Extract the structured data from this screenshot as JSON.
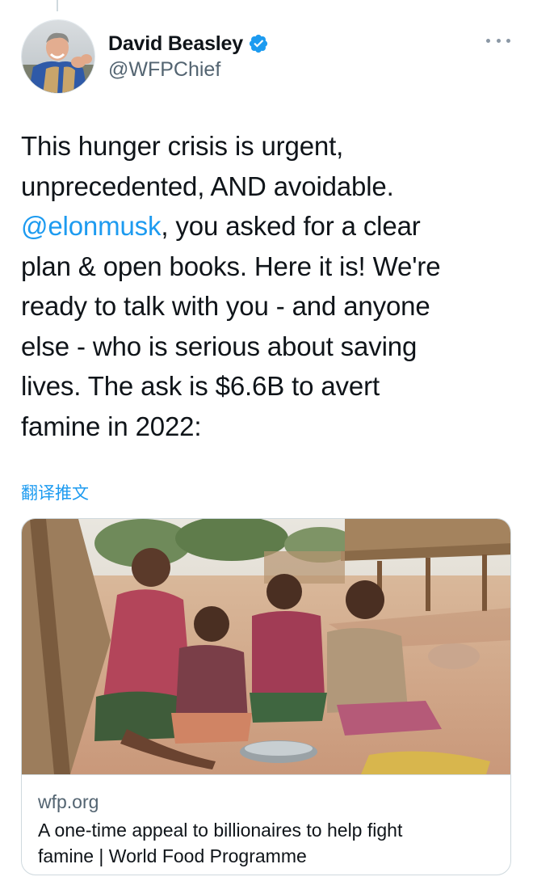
{
  "tweet": {
    "author": {
      "display_name": "David Beasley",
      "handle": "@WFPChief",
      "verified": true
    },
    "text_lines": [
      [
        "This hunger crisis is urgent,"
      ],
      [
        "unprecedented, AND avoidable."
      ],
      [
        "",
        ", you asked for a clear"
      ],
      [
        "plan & open books. Here it is! We're"
      ],
      [
        "ready to talk with you - and anyone"
      ],
      [
        "else - who is serious about saving"
      ],
      [
        "lives. The ask is $6.6B to avert"
      ],
      [
        "famine in 2022:"
      ]
    ],
    "line1": "This hunger crisis is urgent,",
    "line2": "unprecedented, AND avoidable.",
    "mention": "@elonmusk",
    "line3_rest": ", you asked for a clear",
    "line4": "plan & open books. Here it is! We're",
    "line5": "ready to talk with you - and anyone",
    "line6": "else - who is serious about saving",
    "line7": "lives. The ask is $6.6B to avert",
    "line8": "famine in 2022:",
    "translate_label": "翻译推文"
  },
  "link_card": {
    "domain": "wfp.org",
    "title_line1": "A one-time appeal to billionaires to help fight",
    "title_line2": "famine | World Food Programme"
  },
  "colors": {
    "link_blue": "#1d9bf0",
    "verified_blue": "#1d9bf0",
    "secondary_text": "#536471",
    "border": "#cfd9de"
  },
  "icons": {
    "verified": "verified-badge-icon",
    "more": "more-options-icon"
  }
}
